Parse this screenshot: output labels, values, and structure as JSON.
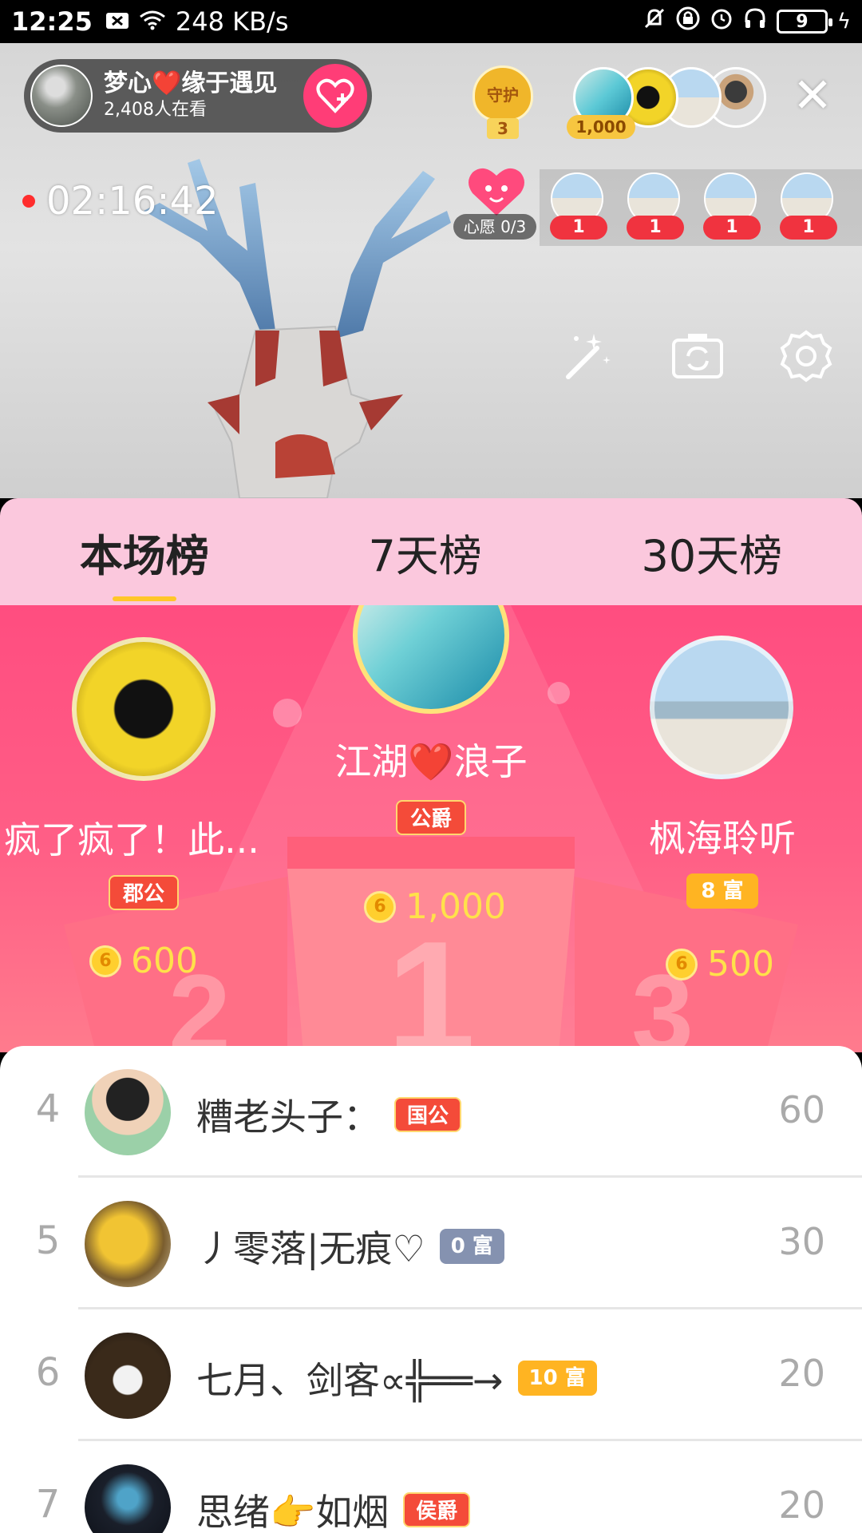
{
  "status_bar": {
    "time": "12:25",
    "speed": "248 KB/s",
    "battery": "9"
  },
  "stream": {
    "host_name": "梦心❤️缘于遇见",
    "viewers": "2,408人在看",
    "guard_label": "守护",
    "guard_count": "3",
    "top_fan_amount": "1,000",
    "timer": "02:16:42",
    "wish_label": "心愿 0/3",
    "viewer_badges": [
      "1",
      "1",
      "1",
      "1"
    ]
  },
  "tabs": [
    "本场榜",
    "7天榜",
    "30天榜"
  ],
  "podium": {
    "first": {
      "name": "江湖❤️浪子",
      "rank_badge": "公爵",
      "score": "1,000"
    },
    "second": {
      "name": "疯了疯了！此...",
      "rank_badge": "郡公",
      "score": "600"
    },
    "third": {
      "name": "枫海聆听",
      "rank_badge": "8 富",
      "score": "500"
    }
  },
  "list": [
    {
      "rank": "4",
      "name": "糟老头子：",
      "badge": "国公",
      "score": "60"
    },
    {
      "rank": "5",
      "name": "丿零落|无痕♡",
      "badge": "0 富",
      "score": "30"
    },
    {
      "rank": "6",
      "name": "七月、剑客∝╬══→",
      "badge": "10 富",
      "score": "20"
    },
    {
      "rank": "7",
      "name": "思绪👉如烟",
      "badge": "侯爵",
      "score": "20"
    }
  ],
  "colors": {
    "accent_pink": "#ff4d80",
    "tab_bg": "#fbc8dd",
    "gold": "#ffe14a",
    "underline": "#ffc729"
  },
  "icons": [
    "mute-icon",
    "wifi-icon",
    "lock-icon",
    "alarm-icon",
    "headphones-icon",
    "battery-icon",
    "follow-heart-icon",
    "close-icon",
    "magic-wand-icon",
    "flip-camera-icon",
    "settings-icon",
    "coin-icon"
  ]
}
